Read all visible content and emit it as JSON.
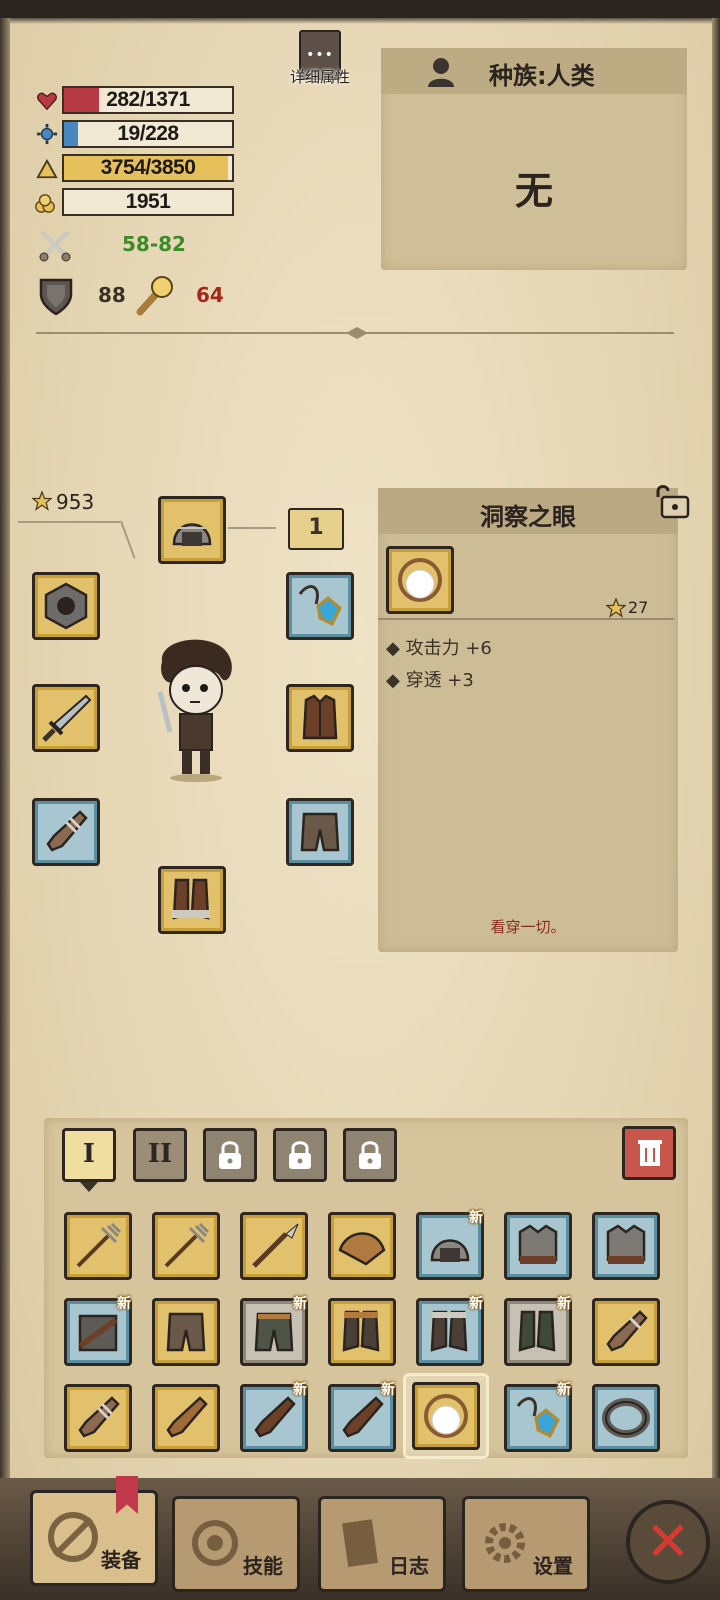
{
  "stats": {
    "hp": {
      "text": "282/1371",
      "ratio": 0.206,
      "color": "#b73a45"
    },
    "mana": {
      "text": "19/228",
      "ratio": 0.083,
      "color": "#4a86c0"
    },
    "exp": {
      "text": "3754/3850",
      "ratio": 0.975,
      "color": "#e6c05a"
    },
    "gold": {
      "text": "1951"
    },
    "attack": "58-82",
    "defense": "88",
    "penetration": "64"
  },
  "detail_button": {
    "label": "详细属性",
    "dots": "•••"
  },
  "race": {
    "title": "种族:人类",
    "value": "无"
  },
  "equipment": {
    "star_total": "953",
    "level_badge": "1"
  },
  "item": {
    "name": "洞察之眼",
    "stars": "27",
    "stats": [
      "攻击力 +6",
      "穿透 +3"
    ],
    "description": "看穿一切。"
  },
  "inventory": {
    "tabs": [
      "I",
      "II"
    ],
    "new_badge": "新"
  },
  "nav": {
    "equip": "装备",
    "skills": "技能",
    "log": "日志",
    "settings": "设置",
    "close": "✕"
  },
  "colors": {
    "gold_frame": "#e1c16c",
    "blue_frame": "#a7c6cf",
    "gray_frame": "#c7c1b3",
    "parchment": "#e9dcbc"
  }
}
